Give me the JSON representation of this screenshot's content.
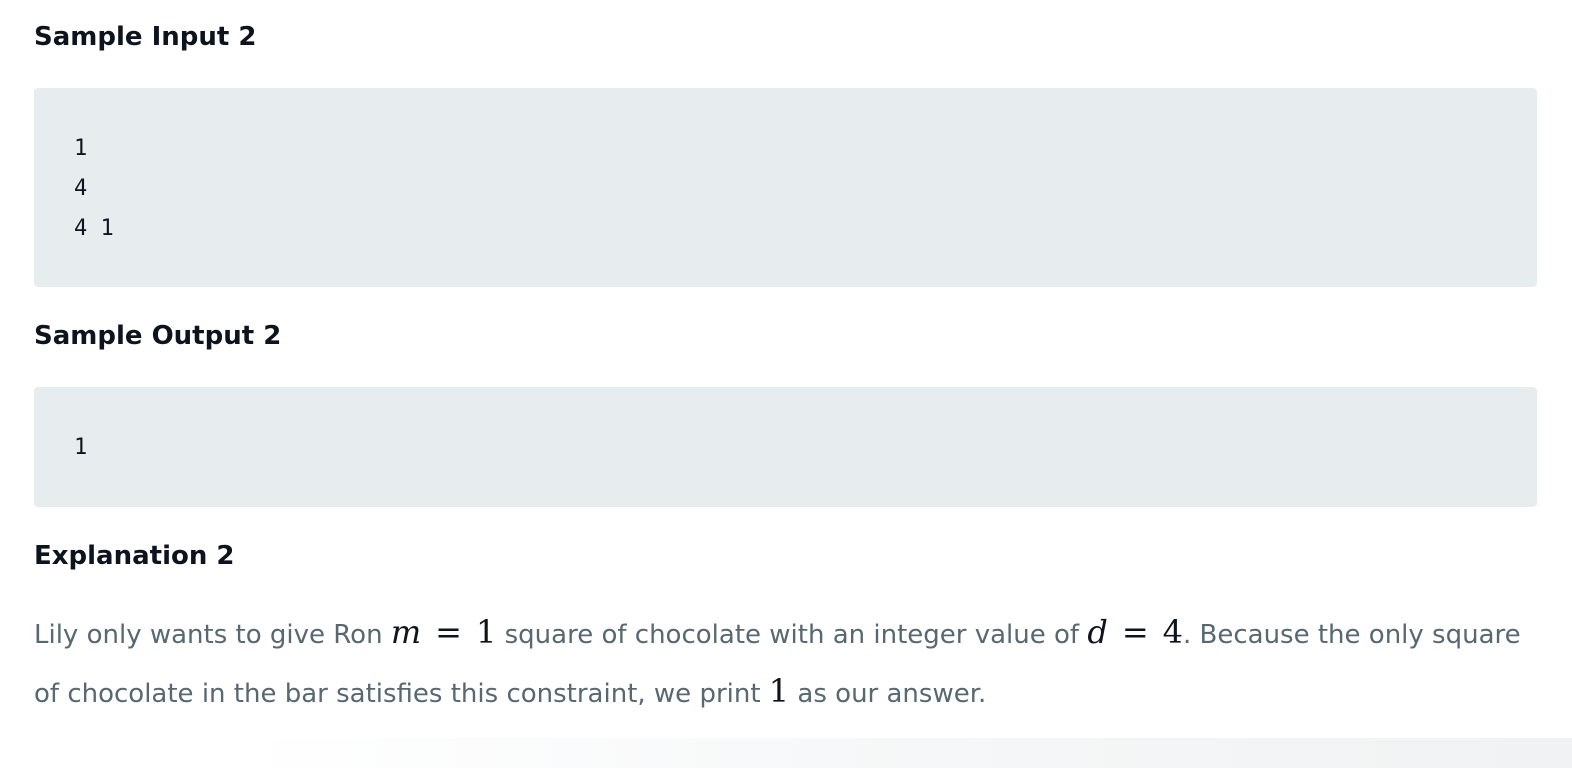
{
  "sections": {
    "sample_input": {
      "heading": "Sample Input 2",
      "lines": [
        "1",
        "4",
        "4 1"
      ]
    },
    "sample_output": {
      "heading": "Sample Output 2",
      "lines": [
        "1"
      ]
    },
    "explanation": {
      "heading": "Explanation 2",
      "text_1": "Lily only wants to give Ron ",
      "math_m_var": "m",
      "math_eq": "=",
      "math_m_val": "1",
      "text_2": " square of chocolate with an integer value of ",
      "math_d_var": "d",
      "math_d_val": "4",
      "text_3": ". Because the only square of chocolate in the bar satisfies this constraint, we print ",
      "math_answer": "1",
      "text_4": " as our answer."
    }
  }
}
